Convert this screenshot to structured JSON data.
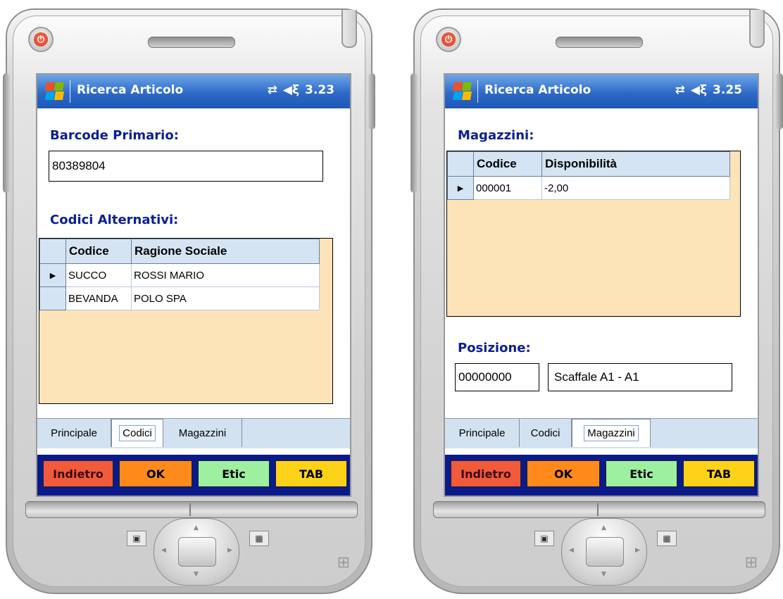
{
  "left": {
    "title": "Ricerca Articolo",
    "time": "3.23",
    "barcode_label": "Barcode Primario:",
    "barcode_value": "80389804",
    "alt_label": "Codici Alternativi:",
    "grid_headers": [
      "Codice",
      "Ragione Sociale"
    ],
    "grid_rows": [
      {
        "codice": "SUCCO",
        "ragione": "ROSSI MARIO"
      },
      {
        "codice": "BEVANDA",
        "ragione": "POLO SPA"
      }
    ],
    "tabs": [
      "Principale",
      "Codici",
      "Magazzini"
    ],
    "active_tab": "Codici",
    "buttons": [
      "Indietro",
      "OK",
      "Etic",
      "TAB"
    ]
  },
  "right": {
    "title": "Ricerca Articolo",
    "time": "3.25",
    "magazzini_label": "Magazzini:",
    "grid_headers": [
      "Codice",
      "Disponibilità"
    ],
    "grid_rows": [
      {
        "codice": "000001",
        "disponibilita": "-2,00"
      }
    ],
    "posizione_label": "Posizione:",
    "posizione_code": "00000000",
    "posizione_desc": "Scaffale A1 - A1",
    "tabs": [
      "Principale",
      "Codici",
      "Magazzini"
    ],
    "active_tab": "Magazzini",
    "buttons": [
      "Indietro",
      "OK",
      "Etic",
      "TAB"
    ]
  },
  "colors": {
    "title_gradient": "#2d69c8",
    "label_blue": "#0b1f8f",
    "grid_fill": "#fde3b8",
    "grid_header": "#d5e4f3",
    "tab_bar": "#d3e2f1",
    "button_bar": "#0a1a8a",
    "btn_indietro": "#f25a3c",
    "btn_ok": "#ff8a1c",
    "btn_etic": "#9df09f",
    "btn_tab": "#ffd21a"
  },
  "icons": [
    "power-icon",
    "windows-logo-icon",
    "connectivity-icon",
    "volume-icon",
    "dpad-icon",
    "softkey-left-icon",
    "softkey-right-icon"
  ]
}
